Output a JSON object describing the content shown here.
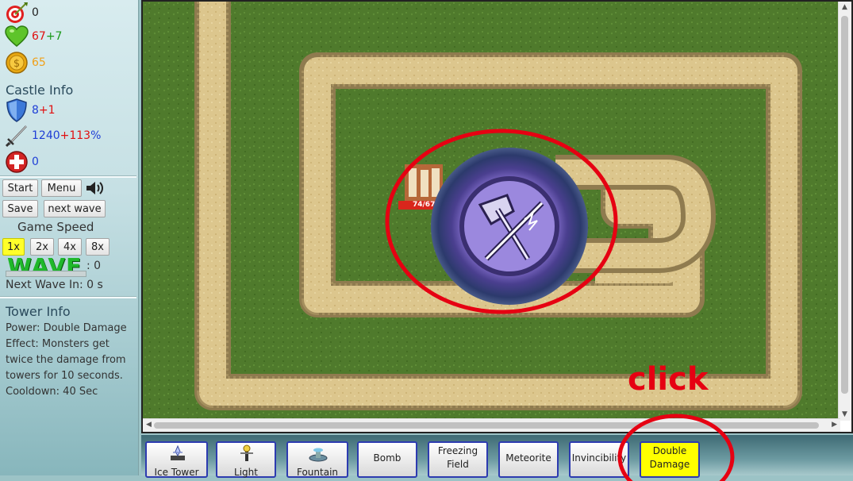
{
  "stats": {
    "target_value": "0",
    "lives_value": "67",
    "lives_bonus": "+7",
    "gold_value": "65"
  },
  "castle": {
    "title": "Castle Info",
    "armor_value": "8",
    "armor_bonus": "+1",
    "attack_value": "1240",
    "attack_bonus": "+113",
    "attack_unit": "%",
    "heal_value": "0"
  },
  "controls": {
    "start": "Start",
    "menu": "Menu",
    "save": "Save",
    "next_wave": "next wave"
  },
  "speed": {
    "title": "Game Speed",
    "options": [
      "1x",
      "2x",
      "4x",
      "8x"
    ],
    "selected": "1x"
  },
  "wave": {
    "label": "WAVE",
    "value": ": 0",
    "next_wave_text": "Next Wave In: 0 s"
  },
  "tower_info": {
    "title": "Tower Info",
    "power": "Power: Double Damage",
    "effect": "Effect: Monsters get twice the damage from towers for 10 seconds.",
    "cooldown": "Cooldown: 40 Sec"
  },
  "map": {
    "monster_hp": "74/67"
  },
  "towers": [
    {
      "label": "Ice Tower"
    },
    {
      "label": "Light"
    },
    {
      "label": "Fountain"
    },
    {
      "label": "Bomb"
    },
    {
      "label": "Freezing Field"
    },
    {
      "label": "Meteorite"
    },
    {
      "label": "Invincibility"
    },
    {
      "label": "Double Damage"
    }
  ],
  "annotation": {
    "click_text": "click",
    "color": "#e60012"
  },
  "colors": {
    "selected": "#ffff00",
    "tower_border": "#2d3bb0",
    "grass": "#4f7a2c",
    "path": "#d9c389"
  }
}
